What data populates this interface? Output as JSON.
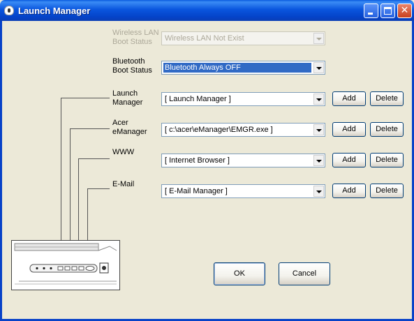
{
  "window": {
    "title": "Launch Manager"
  },
  "wireless": {
    "label_line1": "Wireless LAN",
    "label_line2": "Boot Status",
    "value": "Wireless LAN Not Exist",
    "enabled": false
  },
  "bluetooth": {
    "label_line1": "Bluetooth",
    "label_line2": "Boot Status",
    "value": "Bluetooth Always OFF"
  },
  "rows": [
    {
      "label_line1": "Launch",
      "label_line2": "Manager",
      "value": "[  Launch Manager  ]",
      "add": "Add",
      "delete": "Delete"
    },
    {
      "label_line1": "Acer",
      "label_line2": "eManager",
      "value": "[  c:\\acer\\eManager\\EMGR.exe  ]",
      "add": "Add",
      "delete": "Delete"
    },
    {
      "label_line1": "WWW",
      "label_line2": "",
      "value": "[  Internet Browser  ]",
      "add": "Add",
      "delete": "Delete"
    },
    {
      "label_line1": "E-Mail",
      "label_line2": "",
      "value": "[  E-Mail Manager  ]",
      "add": "Add",
      "delete": "Delete"
    }
  ],
  "buttons": {
    "ok": "OK",
    "cancel": "Cancel"
  },
  "icons": {
    "app": "launch-manager-app-icon",
    "minimize": "minimize-icon",
    "maximize": "maximize-icon",
    "close": "close-icon",
    "dropdown": "chevron-down-icon",
    "illustration": "laptop-launch-keys-illustration"
  },
  "colors": {
    "titlebar": "#0A56DE",
    "dialog_bg": "#ECE9D8",
    "selection": "#316AC5",
    "close_button": "#C8401E"
  }
}
